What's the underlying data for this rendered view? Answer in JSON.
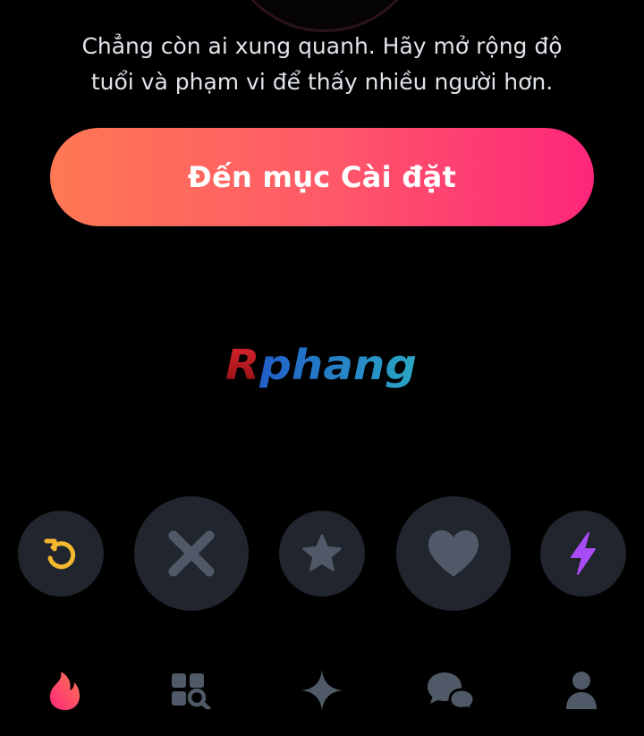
{
  "message": {
    "line1": "Chẳng còn ai xung quanh. Hãy mở rộng độ",
    "line2": "tuổi và phạm vi để thấy nhiều người hơn."
  },
  "settings_button": {
    "label": "Đến mục Cài đặt"
  },
  "watermark": {
    "text": "Rphang"
  },
  "colors": {
    "background": "#000000",
    "gradient_start": "#ff7854",
    "gradient_end": "#fd267a",
    "action_button_bg": "#21252e",
    "icon_gray": "#505967",
    "rewind_yellow": "#f5b82e",
    "boost_purple": "#a94cf5",
    "active_tab": "#fd3a73"
  },
  "action_buttons": [
    {
      "name": "rewind",
      "icon": "rewind-icon"
    },
    {
      "name": "nope",
      "icon": "close-icon"
    },
    {
      "name": "super-like",
      "icon": "star-icon"
    },
    {
      "name": "like",
      "icon": "heart-icon"
    },
    {
      "name": "boost",
      "icon": "lightning-icon"
    }
  ],
  "tabs": [
    {
      "name": "home",
      "icon": "flame-icon",
      "active": true
    },
    {
      "name": "explore",
      "icon": "grid-search-icon",
      "active": false
    },
    {
      "name": "gold",
      "icon": "sparkle-icon",
      "active": false
    },
    {
      "name": "messages",
      "icon": "chat-bubbles-icon",
      "active": false
    },
    {
      "name": "profile",
      "icon": "person-icon",
      "active": false
    }
  ]
}
